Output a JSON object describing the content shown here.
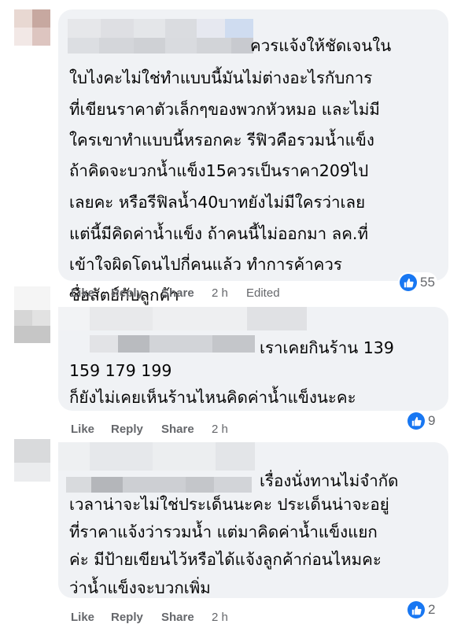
{
  "comments": [
    {
      "lines": [
        "ควรแจ้งให้ชัดเจนใน",
        "ใบไงคะไม่ใช่ทำแบบนี้มันไม่ต่างอะไรกับการ",
        "ที่เขียนราคาตัวเล็กๆของพวกหัวหมอ และไม่มี",
        "ใครเขาทำแบบนี้หรอกคะ รีฟิวคือรวมน้ำแข็ง",
        "ถ้าคิดจะบวกน้ำแข็ง15ควรเป็นราคา209ไป",
        "เลยคะ หรือรีฟิลน้ำ40บาทยังไม่มีใครว่าเลย",
        "แต่นี้มีคิดค่าน้ำแข็ง ถ้าคนนี้ไม่ออกมา ลค.ที่",
        "เข้าใจผิดโดนไปกี่คนแล้ว ทำการค้าควร",
        "ซื่อสัตย์กับลูกค้า"
      ],
      "like_label": "Like",
      "reply_label": "Reply",
      "share_label": "Share",
      "time": "2 h",
      "edited": "Edited",
      "reaction_count": "55"
    },
    {
      "lines": [
        "เราเคยกินร้าน 139",
        "159 179 199",
        "ก็ยังไม่เคยเห็นร้านไหนคิดค่าน้ำแข็งนะคะ"
      ],
      "like_label": "Like",
      "reply_label": "Reply",
      "share_label": "Share",
      "time": "2 h",
      "reaction_count": "9"
    },
    {
      "lines": [
        "เรื่องนั่งทานไม่จำกัด",
        "เวลาน่าจะไม่ใช่ประเด็นนะคะ ประเด็นน่าจะอยู่",
        "ที่ราคาแจ้งว่ารวมน้ำ แต่มาคิดค่าน้ำแข็งแยก",
        "ค่ะ มีป้ายเขียนไว้หรือได้แจ้งลูกค้าก่อนไหมคะ",
        "ว่าน้ำแข็งจะบวกเพิ่ม"
      ],
      "like_label": "Like",
      "reply_label": "Reply",
      "share_label": "Share",
      "time": "2 h",
      "reaction_count": "2"
    }
  ],
  "colors": {
    "bubble": "#f0f2f5",
    "action_text": "#65676b",
    "like_blue": "#1877f2"
  },
  "icons": {
    "reaction": "thumbs-up-icon"
  }
}
